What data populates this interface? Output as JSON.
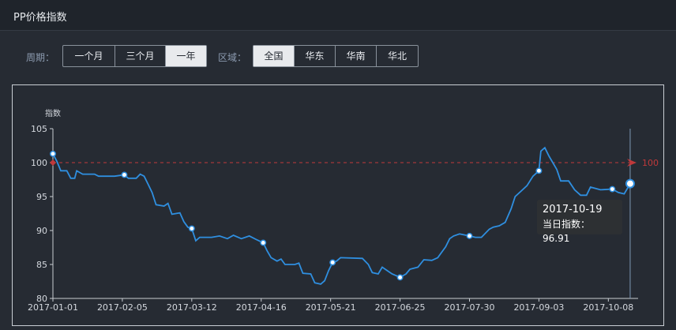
{
  "header": {
    "title": "PP价格指数"
  },
  "filters": {
    "period_label": "周期：",
    "period_options": [
      "一个月",
      "三个月",
      "一年"
    ],
    "period_selected": "一年",
    "region_label": "区域：",
    "region_options": [
      "全国",
      "华东",
      "华南",
      "华北"
    ],
    "region_selected": "全国"
  },
  "tooltip": {
    "date": "2017-10-19",
    "text": "当日指数：96.91"
  },
  "colors": {
    "line": "#2f8fe0",
    "reference": "#c0393b",
    "background": "#262b33",
    "axis": "#c8ccd2"
  },
  "chart_data": {
    "type": "line",
    "title": "",
    "ylabel": "指数",
    "xlabel": "",
    "ylim": [
      80,
      105
    ],
    "yticks": [
      80,
      85,
      90,
      95,
      100,
      105
    ],
    "xlim": [
      "2017-01-01",
      "2017-10-23"
    ],
    "xticks": [
      "2017-01-01",
      "2017-02-05",
      "2017-03-12",
      "2017-04-16",
      "2017-05-21",
      "2017-06-25",
      "2017-07-30",
      "2017-09-03",
      "2017-10-08"
    ],
    "grid": false,
    "reference_line": {
      "value": 100,
      "label": "100"
    },
    "series": [
      {
        "values": [
          [
            "2017-01-01",
            101.3
          ],
          [
            "2017-01-03",
            100.2
          ],
          [
            "2017-01-05",
            98.8
          ],
          [
            "2017-01-08",
            98.8
          ],
          [
            "2017-01-10",
            97.7
          ],
          [
            "2017-01-12",
            97.7
          ],
          [
            "2017-01-13",
            98.8
          ],
          [
            "2017-01-16",
            98.3
          ],
          [
            "2017-01-22",
            98.3
          ],
          [
            "2017-01-24",
            98.0
          ],
          [
            "2017-02-01",
            98.0
          ],
          [
            "2017-02-06",
            98.2
          ],
          [
            "2017-02-08",
            97.7
          ],
          [
            "2017-02-12",
            97.7
          ],
          [
            "2017-02-14",
            98.3
          ],
          [
            "2017-02-16",
            98.0
          ],
          [
            "2017-02-18",
            96.8
          ],
          [
            "2017-02-20",
            95.6
          ],
          [
            "2017-02-22",
            93.8
          ],
          [
            "2017-02-26",
            93.6
          ],
          [
            "2017-02-28",
            94.0
          ],
          [
            "2017-03-02",
            92.4
          ],
          [
            "2017-03-06",
            92.6
          ],
          [
            "2017-03-08",
            91.3
          ],
          [
            "2017-03-10",
            90.5
          ],
          [
            "2017-03-12",
            90.3
          ],
          [
            "2017-03-14",
            88.5
          ],
          [
            "2017-03-16",
            89.0
          ],
          [
            "2017-03-22",
            89.0
          ],
          [
            "2017-03-26",
            89.2
          ],
          [
            "2017-03-30",
            88.8
          ],
          [
            "2017-04-02",
            89.3
          ],
          [
            "2017-04-06",
            88.8
          ],
          [
            "2017-04-10",
            89.2
          ],
          [
            "2017-04-14",
            88.6
          ],
          [
            "2017-04-17",
            88.2
          ],
          [
            "2017-04-19",
            87.0
          ],
          [
            "2017-04-21",
            86.0
          ],
          [
            "2017-04-24",
            85.5
          ],
          [
            "2017-04-26",
            85.8
          ],
          [
            "2017-04-28",
            85.0
          ],
          [
            "2017-05-03",
            85.0
          ],
          [
            "2017-05-05",
            85.2
          ],
          [
            "2017-05-07",
            83.7
          ],
          [
            "2017-05-11",
            83.6
          ],
          [
            "2017-05-13",
            82.3
          ],
          [
            "2017-05-16",
            82.1
          ],
          [
            "2017-05-18",
            82.6
          ],
          [
            "2017-05-20",
            84.1
          ],
          [
            "2017-05-22",
            85.3
          ],
          [
            "2017-05-24",
            85.5
          ],
          [
            "2017-05-26",
            86.0
          ],
          [
            "2017-06-06",
            85.9
          ],
          [
            "2017-06-09",
            85.0
          ],
          [
            "2017-06-11",
            83.8
          ],
          [
            "2017-06-14",
            83.6
          ],
          [
            "2017-06-16",
            84.6
          ],
          [
            "2017-06-18",
            84.2
          ],
          [
            "2017-06-21",
            83.6
          ],
          [
            "2017-06-25",
            83.1
          ],
          [
            "2017-06-28",
            83.6
          ],
          [
            "2017-06-30",
            84.3
          ],
          [
            "2017-07-04",
            84.6
          ],
          [
            "2017-07-07",
            85.7
          ],
          [
            "2017-07-11",
            85.6
          ],
          [
            "2017-07-14",
            86.0
          ],
          [
            "2017-07-16",
            86.8
          ],
          [
            "2017-07-18",
            87.6
          ],
          [
            "2017-07-20",
            88.8
          ],
          [
            "2017-07-22",
            89.2
          ],
          [
            "2017-07-25",
            89.5
          ],
          [
            "2017-07-30",
            89.2
          ],
          [
            "2017-08-02",
            89.0
          ],
          [
            "2017-08-05",
            89.0
          ],
          [
            "2017-08-09",
            90.2
          ],
          [
            "2017-08-11",
            90.5
          ],
          [
            "2017-08-14",
            90.7
          ],
          [
            "2017-08-17",
            91.2
          ],
          [
            "2017-08-20",
            93.2
          ],
          [
            "2017-08-22",
            95.0
          ],
          [
            "2017-08-25",
            95.8
          ],
          [
            "2017-08-28",
            96.6
          ],
          [
            "2017-08-31",
            98.0
          ],
          [
            "2017-09-03",
            98.8
          ],
          [
            "2017-09-04",
            101.7
          ],
          [
            "2017-09-06",
            102.2
          ],
          [
            "2017-09-08",
            101.0
          ],
          [
            "2017-09-10",
            100.0
          ],
          [
            "2017-09-12",
            99.0
          ],
          [
            "2017-09-14",
            97.3
          ],
          [
            "2017-09-18",
            97.3
          ],
          [
            "2017-09-21",
            96.0
          ],
          [
            "2017-09-24",
            95.2
          ],
          [
            "2017-09-27",
            95.2
          ],
          [
            "2017-09-29",
            96.4
          ],
          [
            "2017-10-04",
            96.0
          ],
          [
            "2017-10-10",
            96.1
          ],
          [
            "2017-10-13",
            95.6
          ],
          [
            "2017-10-16",
            95.4
          ],
          [
            "2017-10-19",
            96.91
          ]
        ]
      }
    ],
    "markers": [
      "2017-01-01",
      "2017-02-06",
      "2017-03-12",
      "2017-04-17",
      "2017-05-22",
      "2017-06-25",
      "2017-07-30",
      "2017-09-03",
      "2017-10-10",
      "2017-10-19"
    ]
  }
}
